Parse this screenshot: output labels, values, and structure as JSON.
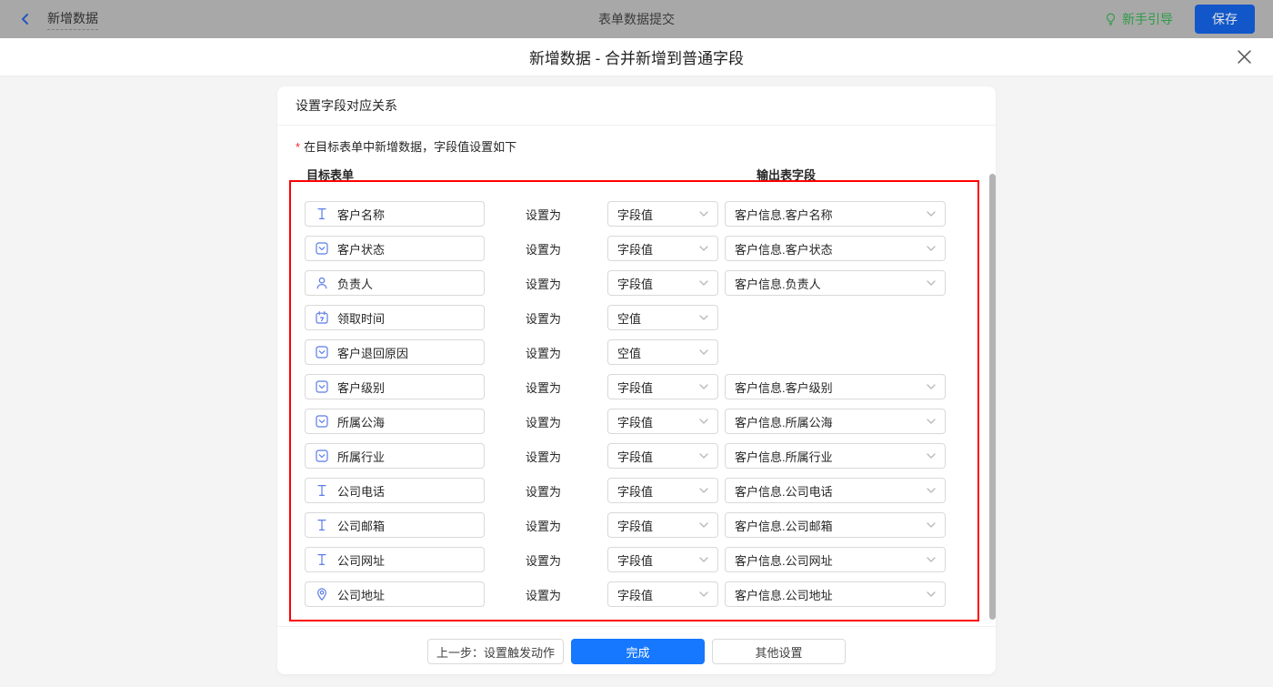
{
  "topbar": {
    "back_label": "新增数据",
    "title": "表单数据提交",
    "guide_label": "新手引导",
    "save_label": "保存"
  },
  "dialog": {
    "title": "新增数据 - 合并新增到普通字段"
  },
  "card": {
    "header": "设置字段对应关系",
    "instruction": "在目标表单中新增数据，字段值设置如下",
    "col_left": "目标表单",
    "col_right": "输出表字段",
    "rows": [
      {
        "icon": "text-field-icon",
        "field": "客户名称",
        "set_as": "设置为",
        "mode": "字段值",
        "output": "客户信息.客户名称"
      },
      {
        "icon": "select-field-icon",
        "field": "客户状态",
        "set_as": "设置为",
        "mode": "字段值",
        "output": "客户信息.客户状态"
      },
      {
        "icon": "person-field-icon",
        "field": "负责人",
        "set_as": "设置为",
        "mode": "字段值",
        "output": "客户信息.负责人"
      },
      {
        "icon": "calendar-field-icon",
        "field": "领取时间",
        "set_as": "设置为",
        "mode": "空值",
        "output": null
      },
      {
        "icon": "select-field-icon",
        "field": "客户退回原因",
        "set_as": "设置为",
        "mode": "空值",
        "output": null
      },
      {
        "icon": "select-field-icon",
        "field": "客户级别",
        "set_as": "设置为",
        "mode": "字段值",
        "output": "客户信息.客户级别"
      },
      {
        "icon": "select-field-icon",
        "field": "所属公海",
        "set_as": "设置为",
        "mode": "字段值",
        "output": "客户信息.所属公海"
      },
      {
        "icon": "select-field-icon",
        "field": "所属行业",
        "set_as": "设置为",
        "mode": "字段值",
        "output": "客户信息.所属行业"
      },
      {
        "icon": "text-field-icon",
        "field": "公司电话",
        "set_as": "设置为",
        "mode": "字段值",
        "output": "客户信息.公司电话"
      },
      {
        "icon": "text-field-icon",
        "field": "公司邮箱",
        "set_as": "设置为",
        "mode": "字段值",
        "output": "客户信息.公司邮箱"
      },
      {
        "icon": "text-field-icon",
        "field": "公司网址",
        "set_as": "设置为",
        "mode": "字段值",
        "output": "客户信息.公司网址"
      },
      {
        "icon": "location-field-icon",
        "field": "公司地址",
        "set_as": "设置为",
        "mode": "字段值",
        "output": "客户信息.公司地址"
      }
    ],
    "footer": {
      "prev_label": "上一步：设置触发动作",
      "done_label": "完成",
      "other_label": "其他设置"
    }
  },
  "colors": {
    "accent": "#1677ff",
    "red": "#ff0000",
    "icon-blue": "#5b7ce8",
    "green": "#2d9c47",
    "topbar-save": "#1257c9",
    "topbar-bg": "#a8a8a8"
  }
}
